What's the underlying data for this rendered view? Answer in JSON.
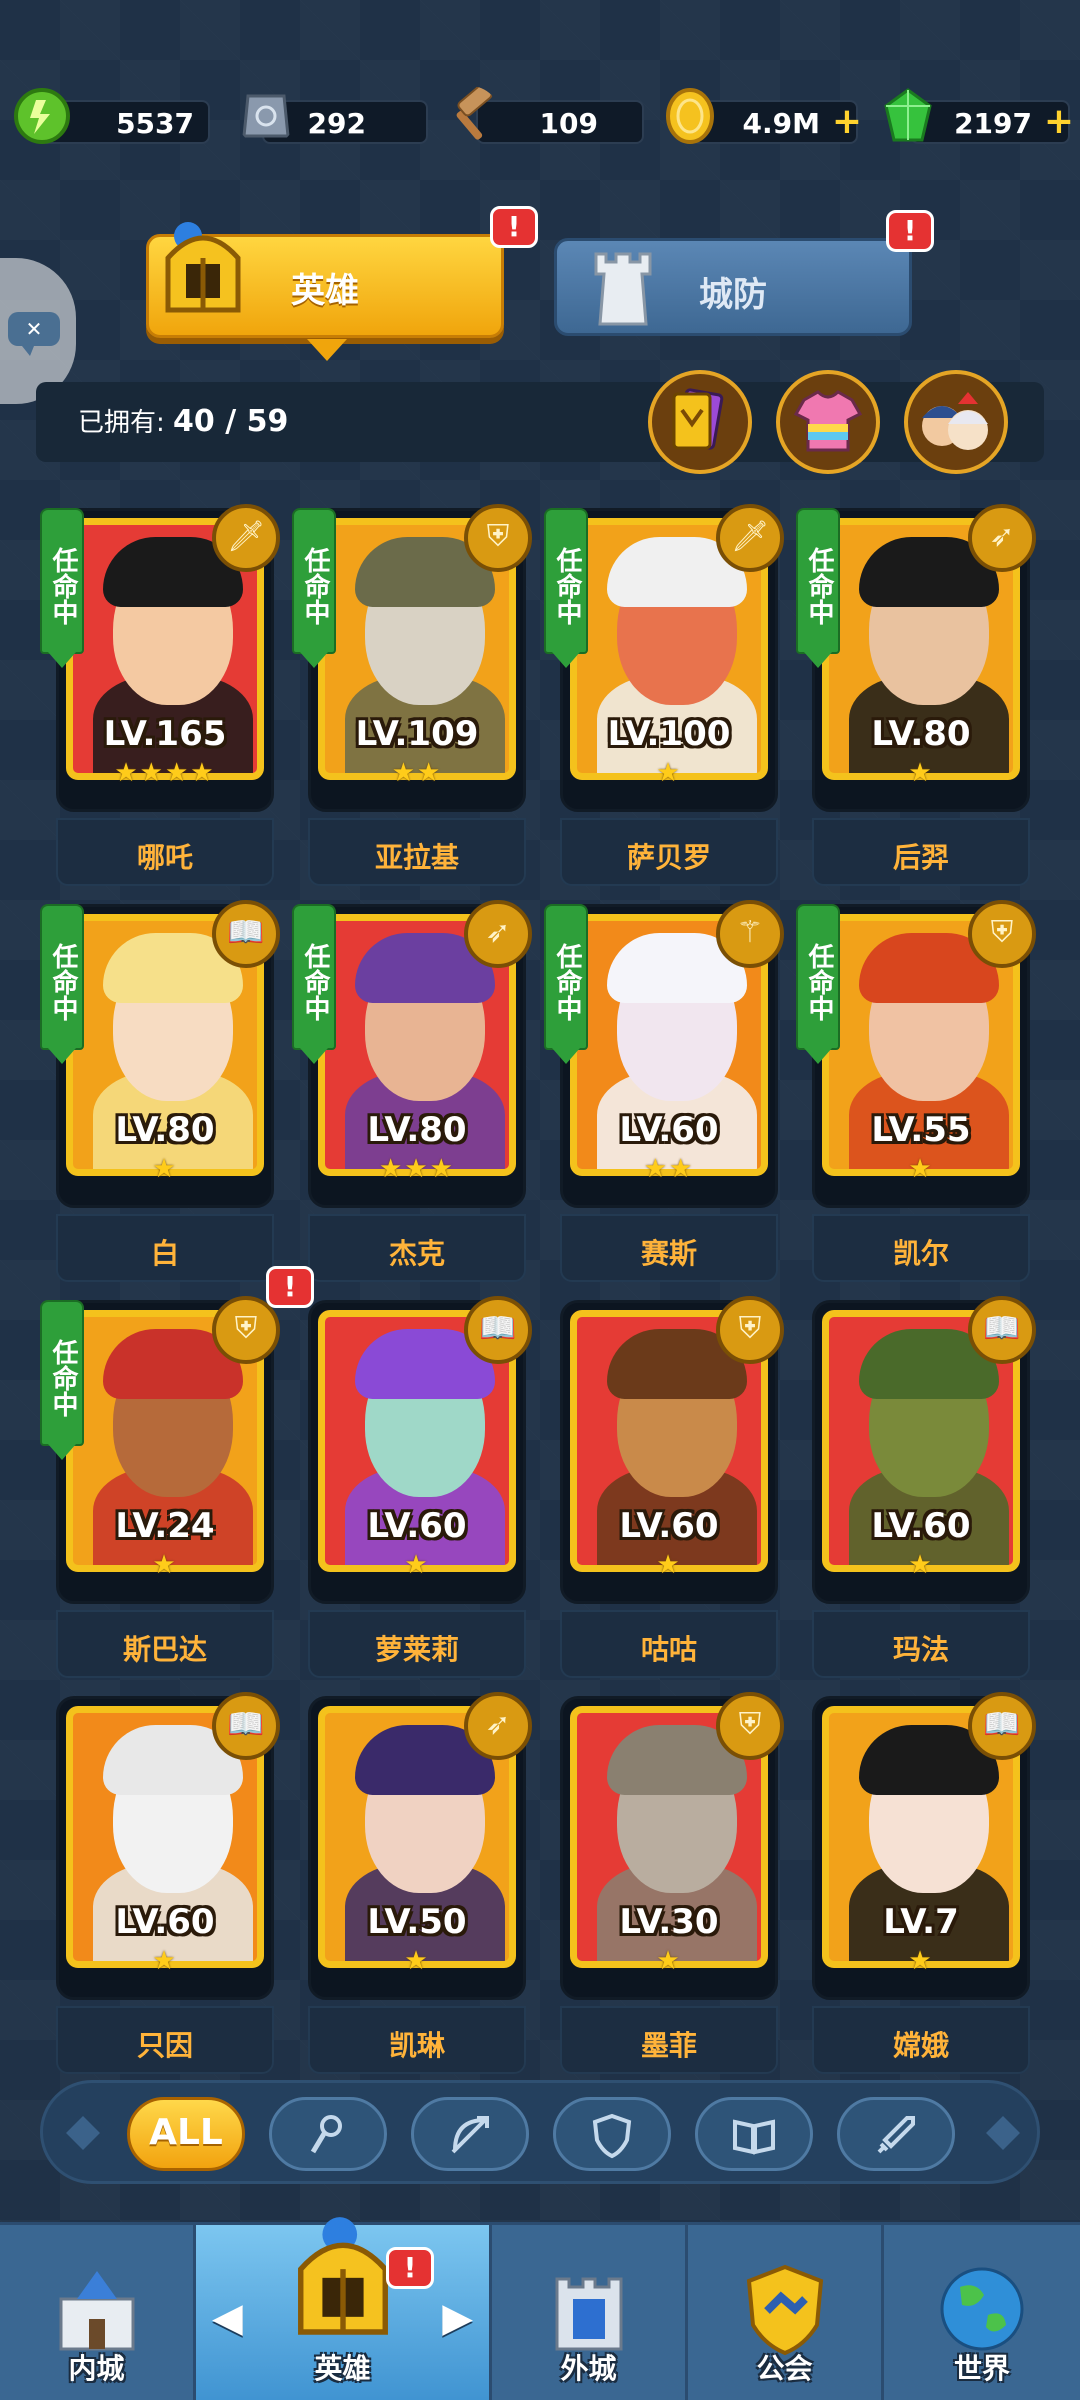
{
  "resources": [
    {
      "icon": "energy-icon",
      "value": "5537",
      "plus": false
    },
    {
      "icon": "stone-icon",
      "value": "292",
      "plus": false
    },
    {
      "icon": "hammer-icon",
      "value": "109",
      "plus": false
    },
    {
      "icon": "gold-coin-icon",
      "value": "4.9M",
      "plus": true,
      "plus_label": "+"
    },
    {
      "icon": "gem-icon",
      "value": "2197",
      "plus": true,
      "plus_label": "+"
    }
  ],
  "tabs": {
    "hero": "英雄",
    "city_defense": "城防",
    "notify": "!"
  },
  "owned": {
    "label": "已拥有:",
    "count": "40 / 59"
  },
  "ribbon_label": "任命中",
  "heroes": [
    {
      "name": "哪吒",
      "level": "LV.165",
      "stars": "★★★★",
      "class_icon": "sword-icon",
      "appointed": true,
      "bg": "#e53b35"
    },
    {
      "name": "亚拉基",
      "level": "LV.109",
      "stars": "★★",
      "class_icon": "shield-icon",
      "appointed": true,
      "bg": "#f2a21a"
    },
    {
      "name": "萨贝罗",
      "level": "LV.100",
      "stars": "★",
      "class_icon": "sword-icon",
      "appointed": true,
      "bg": "#f2a21a"
    },
    {
      "name": "后羿",
      "level": "LV.80",
      "stars": "★",
      "class_icon": "bow-icon",
      "appointed": true,
      "bg": "#f2a21a"
    },
    {
      "name": "白",
      "level": "LV.80",
      "stars": "★",
      "class_icon": "book-icon",
      "appointed": true,
      "bg": "#f2a21a"
    },
    {
      "name": "杰克",
      "level": "LV.80",
      "stars": "★★★",
      "class_icon": "bow-icon",
      "appointed": true,
      "bg": "#e53b35"
    },
    {
      "name": "赛斯",
      "level": "LV.60",
      "stars": "★★",
      "class_icon": "staff-icon",
      "appointed": true,
      "bg": "#f28a1a"
    },
    {
      "name": "凯尔",
      "level": "LV.55",
      "stars": "★",
      "class_icon": "shield-icon",
      "appointed": true,
      "bg": "#f2a21a"
    },
    {
      "name": "斯巴达",
      "level": "LV.24",
      "stars": "★",
      "class_icon": "shield-icon",
      "appointed": true,
      "bg": "#f2a21a",
      "notify": true
    },
    {
      "name": "萝莱莉",
      "level": "LV.60",
      "stars": "★",
      "class_icon": "book-icon",
      "appointed": false,
      "bg": "#e53b35"
    },
    {
      "name": "咕咕",
      "level": "LV.60",
      "stars": "★",
      "class_icon": "shield-icon",
      "appointed": false,
      "bg": "#e53b35"
    },
    {
      "name": "玛法",
      "level": "LV.60",
      "stars": "★",
      "class_icon": "book-icon",
      "appointed": false,
      "bg": "#e53b35"
    },
    {
      "name": "只因",
      "level": "LV.60",
      "stars": "★",
      "class_icon": "book-icon",
      "appointed": false,
      "bg": "#f28a1a"
    },
    {
      "name": "凯琳",
      "level": "LV.50",
      "stars": "★",
      "class_icon": "bow-icon",
      "appointed": false,
      "bg": "#f2a21a"
    },
    {
      "name": "墨菲",
      "level": "LV.30",
      "stars": "★",
      "class_icon": "shield-icon",
      "appointed": false,
      "bg": "#e53b35"
    },
    {
      "name": "嫦娥",
      "level": "LV.7",
      "stars": "★",
      "class_icon": "book-icon",
      "appointed": false,
      "bg": "#f2a21a"
    }
  ],
  "filters": [
    {
      "label": "ALL",
      "active": true
    },
    {
      "icon": "staff-icon",
      "active": false
    },
    {
      "icon": "bow-icon",
      "active": false
    },
    {
      "icon": "shield-icon",
      "active": false
    },
    {
      "icon": "book-icon",
      "active": false
    },
    {
      "icon": "sword-icon",
      "active": false
    }
  ],
  "nav": [
    {
      "label": "内城",
      "icon": "inner-castle-icon"
    },
    {
      "label": "英雄",
      "icon": "hero-helmet-icon",
      "active": true
    },
    {
      "label": "外城",
      "icon": "outer-city-icon"
    },
    {
      "label": "公会",
      "icon": "guild-icon"
    },
    {
      "label": "世界",
      "icon": "world-globe-icon"
    }
  ],
  "colors": {
    "gold": "#f4c21c",
    "green_ribbon": "#2e9f3a",
    "name_orange": "#ffb33a",
    "notify_red": "#e53232"
  }
}
